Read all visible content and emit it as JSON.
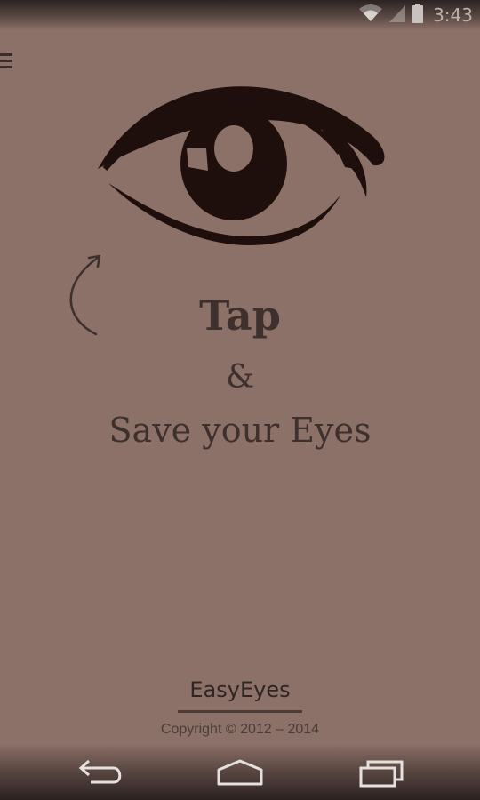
{
  "status_bar": {
    "time": "3:43",
    "icons": [
      "wifi-icon",
      "signal-icon",
      "battery-icon"
    ]
  },
  "header": {
    "menu_icon": "menu-icon"
  },
  "hero": {
    "logo_icon": "eye-icon",
    "hint_icon": "curved-arrow-icon",
    "tap_label": "Tap",
    "ampersand": "&",
    "tagline": "Save your Eyes"
  },
  "footer": {
    "app_name": "EasyEyes",
    "copyright": "Copyright © 2012 – 2014"
  },
  "nav_bar": {
    "buttons": [
      "back-icon",
      "home-icon",
      "recent-apps-icon"
    ]
  },
  "colors": {
    "background": "#8c7168",
    "ink": "#1e0f0d",
    "text": "#3d302d"
  }
}
